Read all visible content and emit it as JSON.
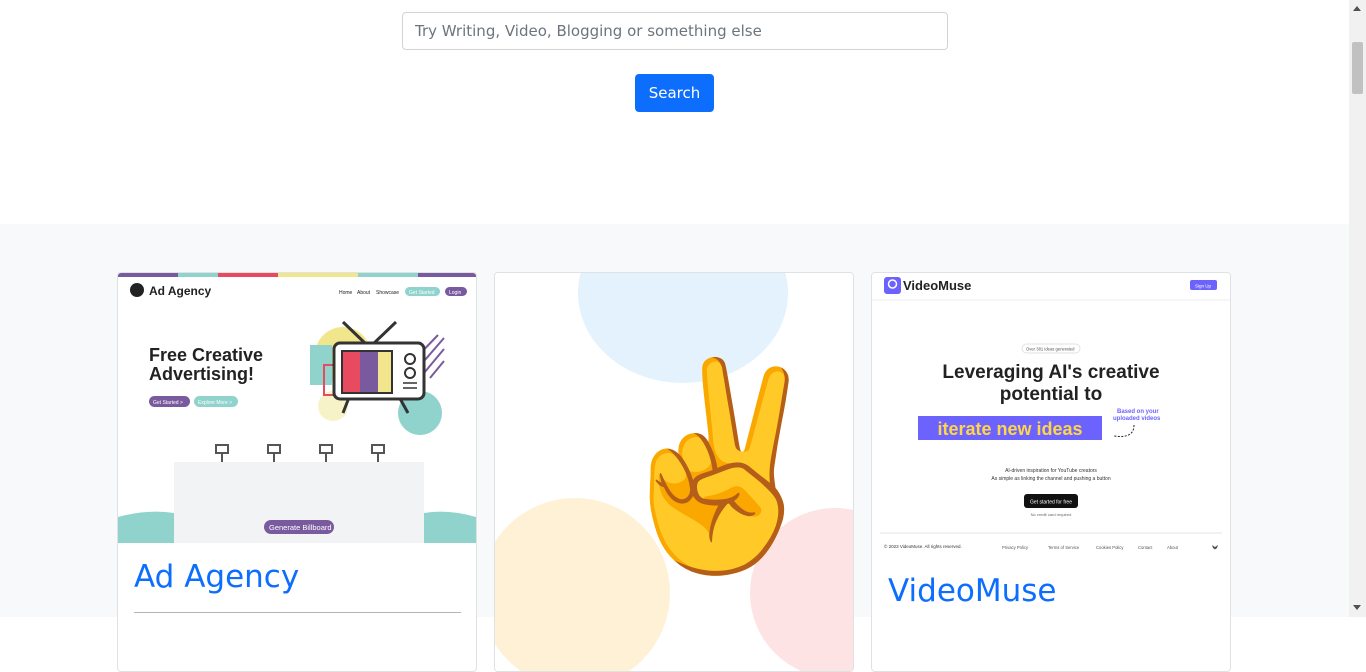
{
  "search": {
    "placeholder": "Try Writing, Video, Blogging or something else",
    "button_label": "Search"
  },
  "cards": [
    {
      "title": "Ad Agency",
      "preview": {
        "brand": "Ad Agency",
        "nav": [
          "Home",
          "About",
          "Showcase"
        ],
        "nav_cta": "Get Started",
        "nav_login": "Login",
        "headline_1": "Free Creative",
        "headline_2": "Advertising!",
        "btn_primary": "Get Started >",
        "btn_secondary": "Explore More >",
        "billboard_button": "Generate Billboard"
      }
    },
    {
      "title": "",
      "preview": {
        "emoji": "✌️"
      }
    },
    {
      "title": "VideoMuse",
      "preview": {
        "brand": "VideoMuse",
        "signup": "Sign Up",
        "badge": "Over 381 ideas generated",
        "headline_1": "Leveraging AI's creative",
        "headline_2": "potential to",
        "highlight": "iterate new ideas",
        "side_note_1": "Based on your",
        "side_note_2": "uploaded videos",
        "sub_1": "AI-driven inspiration for YouTube creators",
        "sub_2": "As simple as linking the channel and pushing a button",
        "cta": "Get started for free",
        "cta_note": "No credit card required",
        "copyright": "© 2023 VideoMuse. All rights reserved.",
        "footer_links": [
          "Privacy Policy",
          "Terms of Service",
          "Cookies Policy",
          "Contact",
          "About"
        ]
      }
    }
  ],
  "colors": {
    "primary": "#0d6efd",
    "ad_purple": "#7a5a9e",
    "ad_teal": "#8fd3cc",
    "vm_purple": "#6c63ff",
    "vm_yellow": "#ffd54a"
  }
}
